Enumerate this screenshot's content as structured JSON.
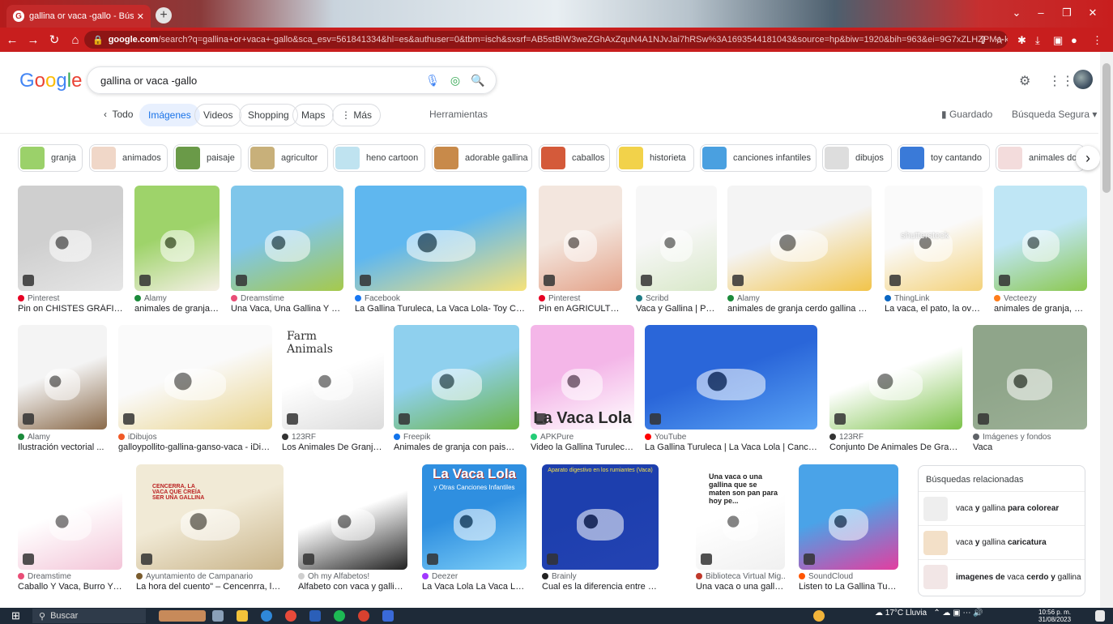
{
  "browser": {
    "tab_title": "gallina or vaca -gallo - Búsqueda",
    "url_host": "google.com",
    "url_rest": "/search?q=gallina+or+vaca+-gallo&sca_esv=561841334&hl=es&authuser=0&tbm=isch&sxsrf=AB5stBiW3weZGhAxZquN4A1NJvJai7hRSw%3A1693544181043&source=hp&biw=1920&bih=963&ei=9G7xZLHZPMa-kPIP9eq1iAI&ifl...",
    "accent": "#c81e1e"
  },
  "google": {
    "logo": "Google",
    "query": "gallina or vaca -gallo"
  },
  "filters": {
    "back": "Todo",
    "items": [
      "Imágenes",
      "Videos",
      "Shopping",
      "Maps"
    ],
    "more": "Más",
    "tools": "Herramientas",
    "saved": "Guardado",
    "safe": "Búsqueda Segura"
  },
  "chips": [
    "granja",
    "animados",
    "paisaje",
    "agricultor",
    "heno cartoon",
    "adorable gallina",
    "caballos",
    "historieta",
    "canciones infantiles",
    "dibujos",
    "toy cantando",
    "animales dom"
  ],
  "results_row1": [
    {
      "src": "Pinterest",
      "cap": "Pin on CHISTES GRÁFICOS",
      "c1": "#cfcfcf",
      "c2": "#e6e6e6",
      "dot": "#e60023"
    },
    {
      "src": "Alamy",
      "cap": "animales de granja ...",
      "c1": "#9ed36a",
      "c2": "#f5f0e6",
      "dot": "#1b8a3b"
    },
    {
      "src": "Dreamstime",
      "cap": "Una Vaca, Una Gallina Y Un ...",
      "c1": "#7fc6ea",
      "c2": "#a6c94b",
      "dot": "#e94e77"
    },
    {
      "src": "Facebook",
      "cap": "La Gallina Turuleca, La Vaca Lola- Toy Canta...",
      "c1": "#5fb7ef",
      "c2": "#f6e27a",
      "dot": "#1877f2"
    },
    {
      "src": "Pinterest",
      "cap": "Pin en AGRICULTUR...",
      "c1": "#f3e6de",
      "c2": "#e4a38a",
      "dot": "#e60023"
    },
    {
      "src": "Scribd",
      "cap": "Vaca y Gallina | PDF",
      "c1": "#f7f7f7",
      "c2": "#d8e8c8",
      "dot": "#1e7b85"
    },
    {
      "src": "Alamy",
      "cap": "animales de granja cerdo gallina de ...",
      "c1": "#f4f4f4",
      "c2": "#f2c44a",
      "dot": "#1b8a3b"
    },
    {
      "src": "ThingLink",
      "cap": "La vaca, el pato, la ovej...",
      "c1": "#fafafa",
      "c2": "#f4d27a",
      "dot": "#0a66c2"
    },
    {
      "src": "Vecteezy",
      "cap": "animales de granja, ce...",
      "c1": "#bfe6f5",
      "c2": "#8cc850",
      "dot": "#ff7d1a"
    }
  ],
  "results_row2": [
    {
      "src": "Alamy",
      "cap": "Ilustración vectorial ...",
      "c1": "#f4f4f4",
      "c2": "#8a6a4a",
      "dot": "#1b8a3b"
    },
    {
      "src": "iDibujos",
      "cap": "galloypollito-gallina-ganso-vaca - iDibu...",
      "c1": "#fafafa",
      "c2": "#e9d38a",
      "dot": "#f05a28"
    },
    {
      "src": "123RF",
      "cap": "Los Animales De Granja,...",
      "c1": "#ffffff",
      "c2": "#dcdcdc",
      "dot": "#333333"
    },
    {
      "src": "Freepik",
      "cap": "Animales de granja con paisaje...",
      "c1": "#8fd0ee",
      "c2": "#6cb546",
      "dot": "#1273eb"
    },
    {
      "src": "APKPure",
      "cap": "Video la Gallina Turuleca ...",
      "c1": "#f4b6e8",
      "c2": "#ffffff",
      "dot": "#24cd77"
    },
    {
      "src": "YouTube",
      "cap": "La Gallina Turuleca | La Vaca Lola | Cancion...",
      "c1": "#2a66d9",
      "c2": "#5aa4f5",
      "dot": "#ff0000"
    },
    {
      "src": "123RF",
      "cap": "Conjunto De Animales De Granja ...",
      "c1": "#ffffff",
      "c2": "#7cc24a",
      "dot": "#333333"
    },
    {
      "src": "Imágenes y fondos",
      "cap": "Vaca",
      "c1": "#8fa58a",
      "c2": "#9cb096",
      "dot": "#5f6368"
    }
  ],
  "results_row3": [
    {
      "src": "Dreamstime",
      "cap": "Caballo Y Vaca, Burro Y O...",
      "c1": "#ffffff",
      "c2": "#f3c5d8",
      "dot": "#e94e77"
    },
    {
      "src": "Ayuntamiento de Campanario",
      "cap": "La hora del cuento\" – Cencenrra, la vac...",
      "c1": "#f1ead6",
      "c2": "#c9b48a",
      "dot": "#7a5c2e"
    },
    {
      "src": "Oh my Alfabetos!",
      "cap": "Alfabeto con vaca y gallina...",
      "c1": "#ffffff",
      "c2": "#222222",
      "dot": "#cfcfcf"
    },
    {
      "src": "Deezer",
      "cap": "La Vaca Lola La Vaca Lola ...",
      "c1": "#2f8fe0",
      "c2": "#7fd0f8",
      "dot": "#a238ff"
    },
    {
      "src": "Brainly",
      "cap": "Cual es la diferencia entre el sistem...",
      "c1": "#1d3fae",
      "c2": "#2443b3",
      "dot": "#222222"
    },
    {
      "src": "Biblioteca Virtual Mig...",
      "cap": "Una vaca o una gallin...",
      "c1": "#ffffff",
      "c2": "#f0f0f0",
      "dot": "#c0392b"
    },
    {
      "src": "SoundCloud",
      "cap": "Listen to La Gallina Turulec...",
      "c1": "#4aa3e8",
      "c2": "#e33ea0",
      "dot": "#ff5500"
    }
  ],
  "card_text": {
    "lola": "La Vaca Lola",
    "lola2": "La Vaca Lola",
    "lola2sub": "y Otras Canciones Infantiles",
    "digest": "Aparato digestivo en los rumiantes (Vaca)",
    "vaca_gallina": "Una vaca o una gallina que se maten son pan para hoy pe...",
    "cencerra": "CENCERRA, LA VACA QUE CREÍA SER UNA GALLINA",
    "farm": "Farm Animals",
    "shutter": "shutterstock"
  },
  "related": {
    "title": "Búsquedas relacionadas",
    "items": [
      {
        "pre": "vaca ",
        "b1": "y",
        "mid": " gallina ",
        "b2": "para colorear",
        "post": ""
      },
      {
        "pre": "vaca ",
        "b1": "y",
        "mid": " gallina ",
        "b2": "caricatura",
        "post": ""
      },
      {
        "pre": "",
        "b1": "imagenes de",
        "mid": " vaca ",
        "b2": "cerdo y",
        "post": " gallina"
      }
    ]
  },
  "taskbar": {
    "search": "Buscar",
    "weather": "17°C Lluvia",
    "time": "10:56 p. m.",
    "date": "31/08/2023"
  }
}
